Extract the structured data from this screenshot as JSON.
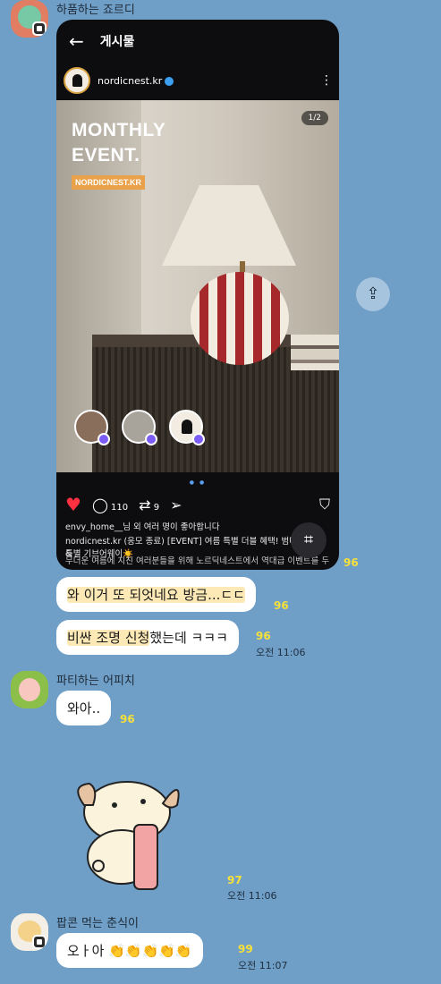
{
  "msg1": {
    "sender": "하품하는 죠르디",
    "count": "96"
  },
  "post": {
    "header_title": "게시물",
    "username": "nordicnest.kr",
    "headline_line1": "MONTHLY",
    "headline_line2": "EVENT.",
    "tag": "NORDICNEST.KR",
    "pager": "1/2",
    "comments": "110",
    "reposts": "9",
    "likes_text": "envy_home__님 외 여러 명이 좋아합니다",
    "caption_1": "nordicnest.kr (응모 종료) [EVENT] 여름 특별 더블 혜택! 범머 부세일 &",
    "caption_2": "특별 기브어웨이☀️",
    "caption_3": "무더운 여름에 지친 여러분들을 위해 노르딕네스트에서 역대급 이벤트를 두"
  },
  "msg2": {
    "text": "와 이거 또 되엇네요 방금...ㄷㄷ",
    "count": "96"
  },
  "msg3": {
    "text_hl": "비싼 조명 신청",
    "text_rest": "했는데 ㅋㅋㅋ",
    "count": "96",
    "time": "오전 11:06"
  },
  "msg4": {
    "sender": "파티하는 어피치",
    "text": "와아..",
    "count": "96"
  },
  "msg5": {
    "count": "97",
    "time": "오전 11:06"
  },
  "msg6": {
    "sender": "팝콘 먹는 춘식이",
    "text": "오ㅏ아 👏👏👏👏👏",
    "count": "99",
    "time": "오전 11:07"
  },
  "colors": {
    "background": "#6f9ec6",
    "unread_count": "#f6e03a",
    "highlight": "#fde9b5",
    "heart": "#ff3040"
  },
  "icons": [
    "back-arrow-icon",
    "more-icon",
    "heart-icon",
    "comment-icon",
    "repost-icon",
    "send-icon",
    "bookmark-icon",
    "lens-icon",
    "share-icon"
  ]
}
